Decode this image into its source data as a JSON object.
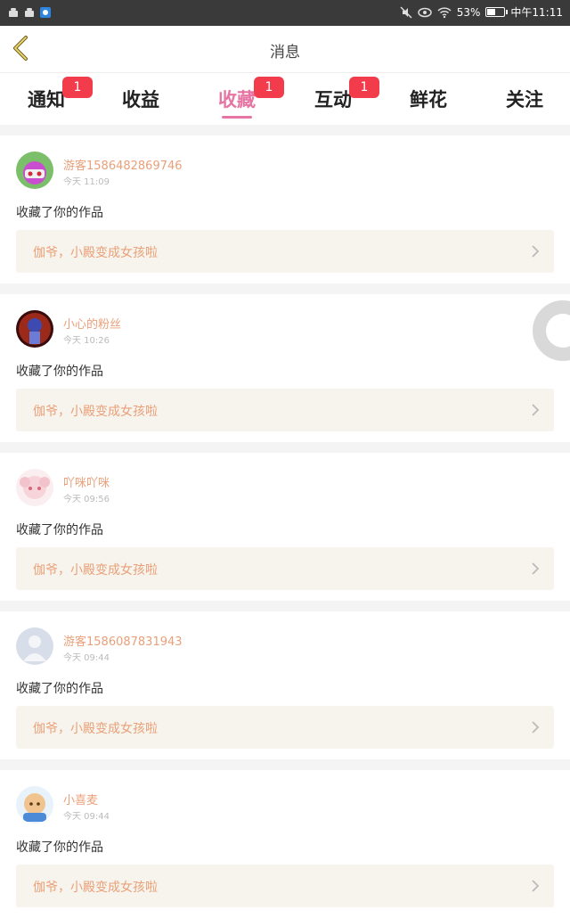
{
  "status_bar": {
    "battery_text": "53%",
    "battery_level": 0.53,
    "time": "中午11:11"
  },
  "header": {
    "title": "消息"
  },
  "tabs": [
    {
      "label": "通知",
      "badge": "1",
      "active": false
    },
    {
      "label": "收益",
      "badge": "",
      "active": false
    },
    {
      "label": "收藏",
      "badge": "1",
      "active": true
    },
    {
      "label": "互动",
      "badge": "1",
      "active": false
    },
    {
      "label": "鲜花",
      "badge": "",
      "active": false
    },
    {
      "label": "关注",
      "badge": "",
      "active": false
    }
  ],
  "items": [
    {
      "user": "游客1586482869746",
      "time": "今天  11:09",
      "action": "收藏了你的作品",
      "work": "伽爷，小殿变成女孩啦",
      "avatar_icon": "anime-avatar-icon"
    },
    {
      "user": "小心的粉丝",
      "time": "今天  10:26",
      "action": "收藏了你的作品",
      "work": "伽爷，小殿变成女孩啦",
      "avatar_icon": "anime-avatar-icon"
    },
    {
      "user": "吖咪吖咪",
      "time": "今天  09:56",
      "action": "收藏了你的作品",
      "work": "伽爷，小殿变成女孩啦",
      "avatar_icon": "anime-avatar-icon"
    },
    {
      "user": "游客1586087831943",
      "time": "今天  09:44",
      "action": "收藏了你的作品",
      "work": "伽爷，小殿变成女孩啦",
      "avatar_icon": "default-user-avatar-icon"
    },
    {
      "user": "小喜麦",
      "time": "今天  09:44",
      "action": "收藏了你的作品",
      "work": "伽爷，小殿变成女孩啦",
      "avatar_icon": "anime-avatar-icon"
    }
  ],
  "colors": {
    "accent": "#e576a4",
    "badge": "#f23c4b",
    "username": "#e9a07a",
    "work_bg": "#f6f4ec"
  }
}
